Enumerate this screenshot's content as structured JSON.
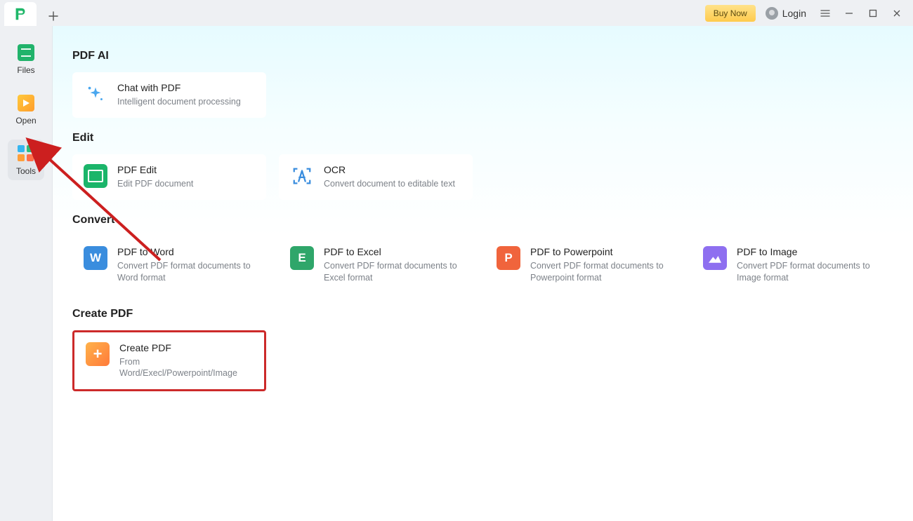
{
  "titlebar": {
    "buy_now": "Buy Now",
    "login": "Login"
  },
  "sidebar": {
    "items": [
      {
        "label": "Files"
      },
      {
        "label": "Open"
      },
      {
        "label": "Tools"
      }
    ]
  },
  "sections": {
    "pdf_ai": {
      "title": "PDF AI",
      "chat": {
        "title": "Chat with PDF",
        "desc": "Intelligent document processing"
      }
    },
    "edit": {
      "title": "Edit",
      "pdf_edit": {
        "title": "PDF Edit",
        "desc": "Edit PDF document"
      },
      "ocr": {
        "title": "OCR",
        "desc": "Convert document to editable text"
      }
    },
    "convert": {
      "title": "Convert",
      "word": {
        "title": "PDF to Word",
        "desc": "Convert PDF format documents to Word format"
      },
      "excel": {
        "title": "PDF to Excel",
        "desc": "Convert PDF format documents to Excel format"
      },
      "ppt": {
        "title": "PDF to Powerpoint",
        "desc": "Convert PDF format documents to Powerpoint format"
      },
      "image": {
        "title": "PDF to Image",
        "desc": "Convert PDF format documents to Image format"
      }
    },
    "create": {
      "title": "Create PDF",
      "create_pdf": {
        "title": "Create PDF",
        "desc": "From Word/Execl/Powerpoint/Image"
      }
    }
  }
}
